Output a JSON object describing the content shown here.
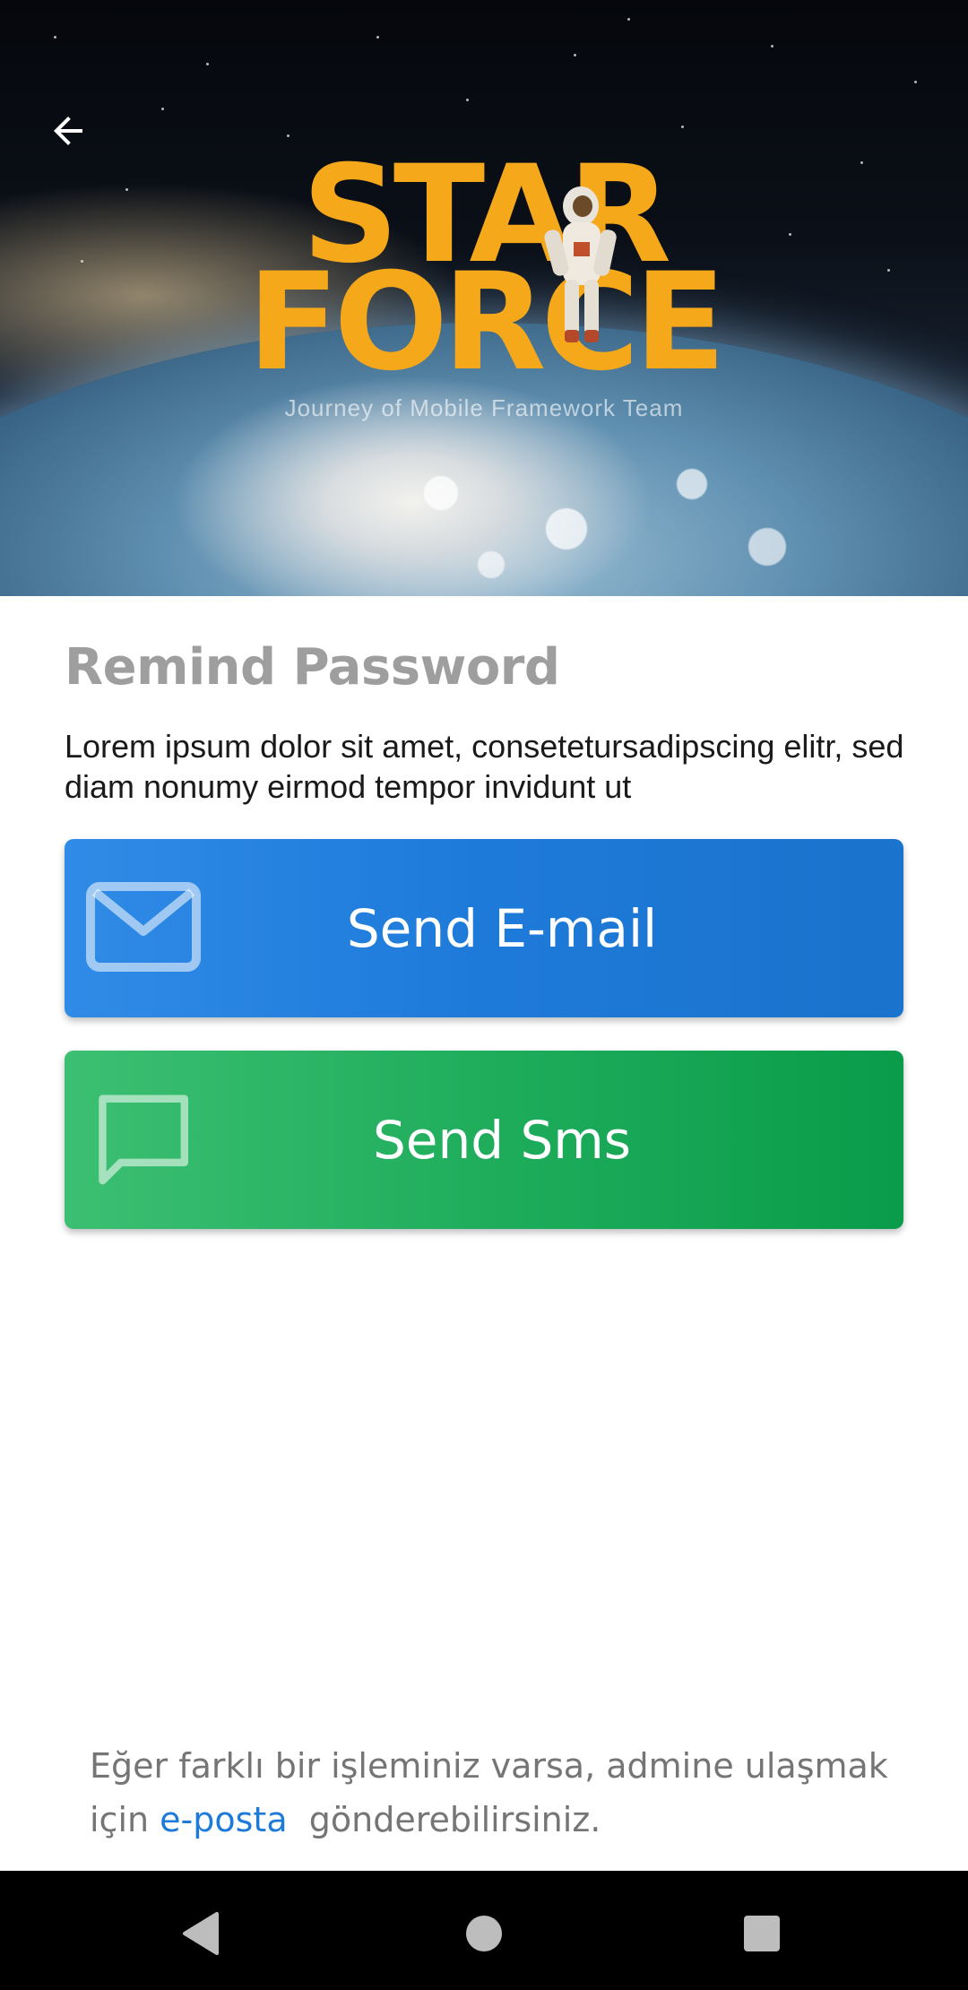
{
  "header": {
    "logo_line1": "STAR",
    "logo_line2": "FORCE",
    "logo_tagline": "Journey of Mobile Framework Team",
    "back_icon": "arrow-left-icon"
  },
  "main": {
    "title": "Remind Password",
    "description": "Lorem ipsum dolor sit amet, consetetursadipscing elitr, sed diam nonumy eirmod tempor invidunt ut",
    "email_button": {
      "label": "Send E-mail",
      "icon": "envelope-icon",
      "color": "#1e7ad9"
    },
    "sms_button": {
      "label": "Send Sms",
      "icon": "message-icon",
      "color": "#1fad5c"
    }
  },
  "footer": {
    "text_before": "Eğer farklı bir işleminiz varsa, admine ulaşmak için ",
    "link_text": "e-posta",
    "text_after": "  gönderebilirsiniz.",
    "link_color": "#1e7ad9"
  },
  "nav_bar": {
    "back_icon": "nav-back-triangle-icon",
    "home_icon": "nav-home-circle-icon",
    "recent_icon": "nav-recent-square-icon"
  },
  "colors": {
    "logo": "#f6a81b",
    "title": "#9e9e9e"
  }
}
